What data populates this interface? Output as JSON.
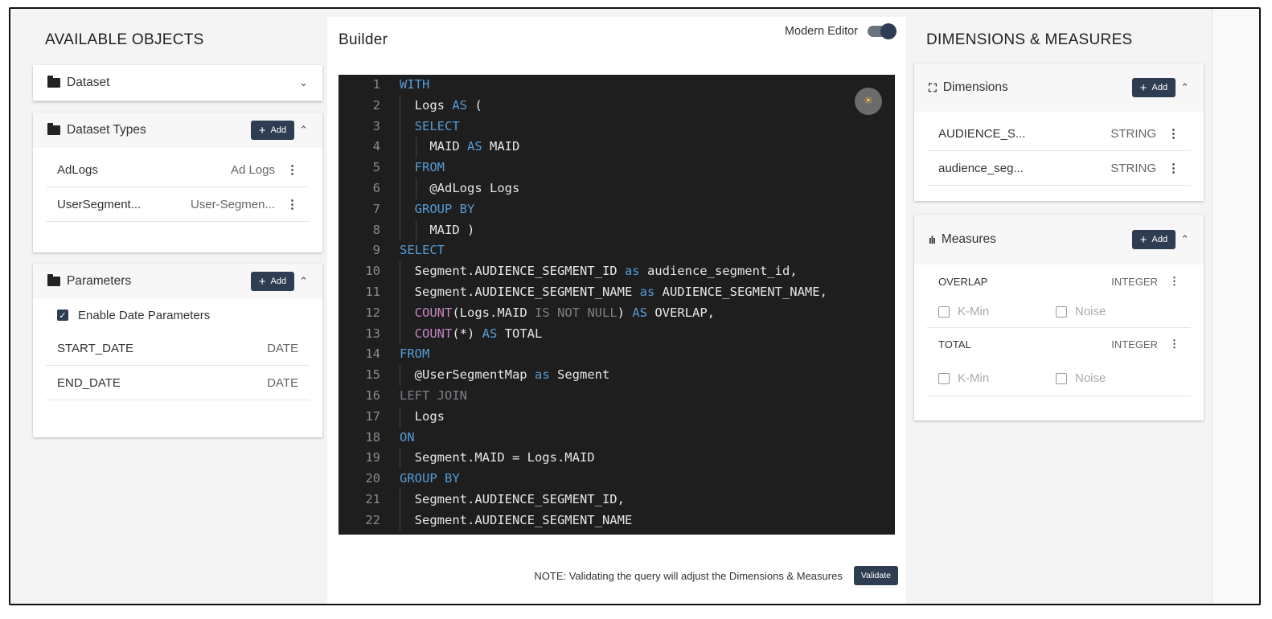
{
  "left": {
    "heading": "AVAILABLE OBJECTS",
    "dataset": {
      "title": "Dataset"
    },
    "dataset_types": {
      "title": "Dataset Types",
      "add_label": "Add",
      "rows": [
        {
          "name": "AdLogs",
          "type": "Ad Logs"
        },
        {
          "name": "UserSegment...",
          "type": "User-Segmen..."
        }
      ]
    },
    "parameters": {
      "title": "Parameters",
      "add_label": "Add",
      "enable_label": "Enable Date Parameters",
      "rows": [
        {
          "name": "START_DATE",
          "type": "DATE"
        },
        {
          "name": "END_DATE",
          "type": "DATE"
        }
      ]
    }
  },
  "center": {
    "heading": "Builder",
    "modern_editor_label": "Modern Editor",
    "note": "NOTE: Validating the query will adjust the Dimensions & Measures",
    "validate_label": "Validate",
    "code_lines": [
      "1",
      "2",
      "3",
      "4",
      "5",
      "6",
      "7",
      "8",
      "9",
      "10",
      "11",
      "12",
      "13",
      "14",
      "15",
      "16",
      "17",
      "18",
      "19",
      "20",
      "21",
      "22"
    ]
  },
  "right": {
    "heading": "DIMENSIONS & MEASURES",
    "dimensions": {
      "title": "Dimensions",
      "add_label": "Add",
      "rows": [
        {
          "name": "AUDIENCE_S...",
          "type": "STRING"
        },
        {
          "name": "audience_seg...",
          "type": "STRING"
        }
      ]
    },
    "measures": {
      "title": "Measures",
      "add_label": "Add",
      "rows": [
        {
          "name": "OVERLAP",
          "type": "INTEGER",
          "kmin": "K-Min",
          "noise": "Noise"
        },
        {
          "name": "TOTAL",
          "type": "INTEGER",
          "kmin": "K-Min",
          "noise": "Noise"
        }
      ]
    }
  },
  "colors": {
    "accent": "#2f3d52",
    "editor_bg": "#1e1e1e",
    "keyword": "#569cd6",
    "function": "#c586c0"
  }
}
